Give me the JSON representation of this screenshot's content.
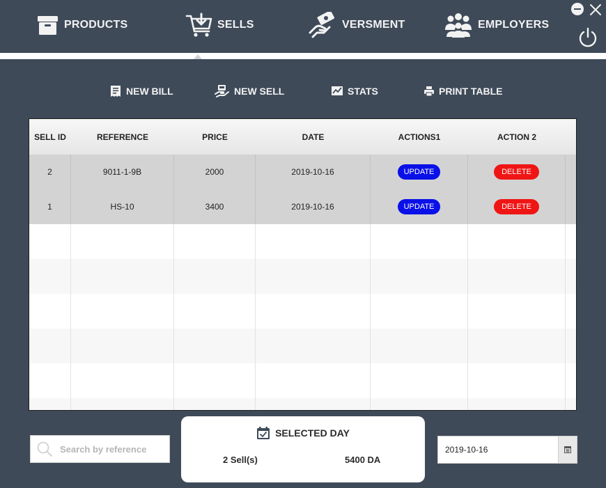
{
  "nav": {
    "products": "PRODUCTS",
    "sells": "SELLS",
    "versment": "VERSMENT",
    "employers": "EMPLOYERS"
  },
  "toolbar": {
    "new_bill": "NEW BILL",
    "new_sell": "NEW SELL",
    "stats": "STATS",
    "print_table": "PRINT TABLE"
  },
  "table": {
    "headers": [
      "SELL ID",
      "REFERENCE",
      "PRICE",
      "DATE",
      "ACTIONS1",
      "ACTION 2"
    ],
    "rows": [
      {
        "id": "2",
        "reference": "9011-1-9B",
        "price": "2000",
        "date": "2019-10-16",
        "update": "UPDATE",
        "delete": "DELETE"
      },
      {
        "id": "1",
        "reference": "HS-10",
        "price": "3400",
        "date": "2019-10-16",
        "update": "UPDATE",
        "delete": "DELETE"
      }
    ]
  },
  "search": {
    "placeholder": "Search by reference",
    "value": ""
  },
  "summary": {
    "title": "SELECTED DAY",
    "count": "2 Sell(s)",
    "total": "5400 DA"
  },
  "date_picker": {
    "value": "2019-10-16"
  },
  "colors": {
    "background": "#3e4a58",
    "update_button": "#0a10e8",
    "delete_button": "#f01515",
    "filled_row": "#d3d3d3"
  },
  "icons": {
    "products": "box-icon",
    "sells": "cart-icon",
    "versment": "money-hand-icon",
    "employers": "people-icon",
    "new_bill": "receipt-icon",
    "new_sell": "register-icon",
    "stats": "chart-icon",
    "print_table": "printer-icon",
    "search": "search-icon",
    "selected_day": "calendar-check-icon",
    "date_picker": "calendar-icon",
    "minimize": "minimize-icon",
    "close": "close-icon",
    "power": "power-icon"
  }
}
